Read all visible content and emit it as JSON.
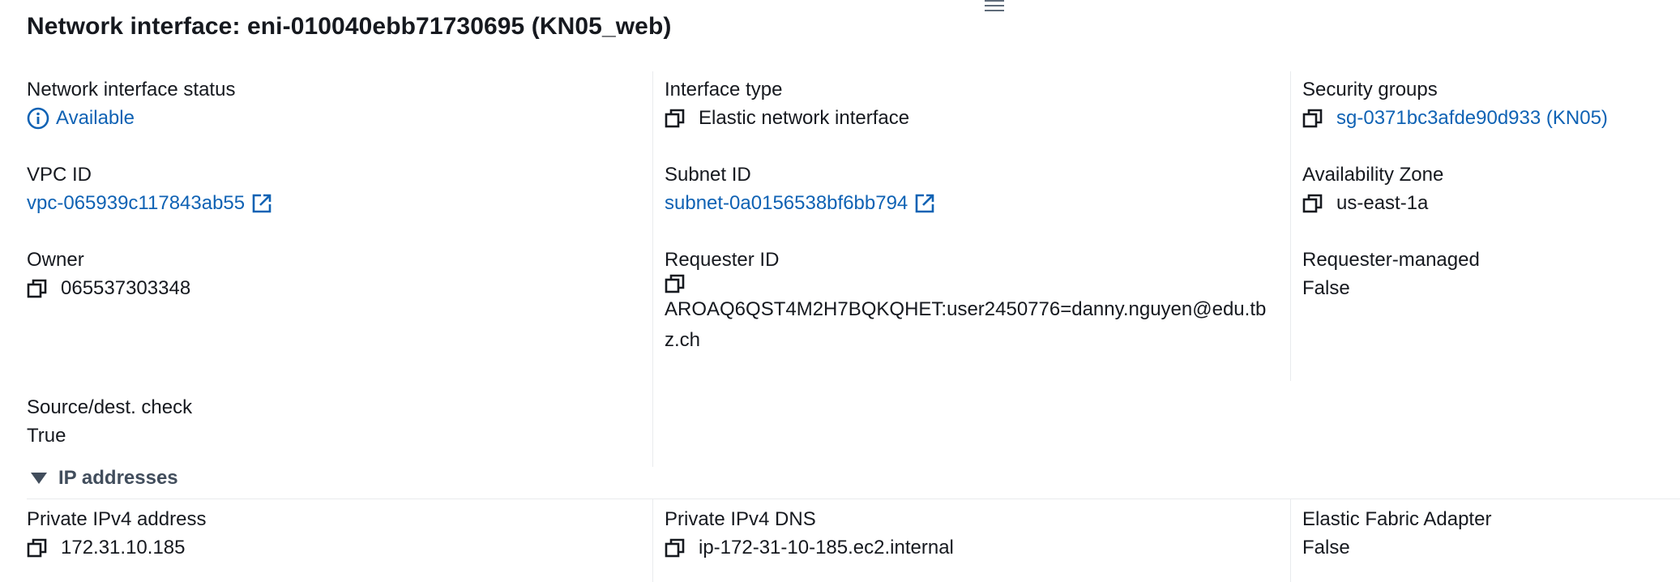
{
  "header": {
    "title": "Network interface: eni-010040ebb71730695 (KN05_web)"
  },
  "details": {
    "status": {
      "label": "Network interface status",
      "value": "Available"
    },
    "interface_type": {
      "label": "Interface type",
      "value": "Elastic network interface"
    },
    "security_groups": {
      "label": "Security groups",
      "value": "sg-0371bc3afde90d933 (KN05)"
    },
    "vpc_id": {
      "label": "VPC ID",
      "value": "vpc-065939c117843ab55"
    },
    "subnet_id": {
      "label": "Subnet ID",
      "value": "subnet-0a0156538bf6bb794"
    },
    "availability_zone": {
      "label": "Availability Zone",
      "value": "us-east-1a"
    },
    "owner": {
      "label": "Owner",
      "value": "065537303348"
    },
    "requester_id": {
      "label": "Requester ID",
      "value_line1": "AROAQ6QST4M2H7BQKQHET:user2450776=danny.nguyen@edu.tb",
      "value_line2": "z.ch"
    },
    "requester_managed": {
      "label": "Requester-managed",
      "value": "False"
    },
    "source_dest_check": {
      "label": "Source/dest. check",
      "value": "True"
    }
  },
  "ip_section": {
    "title": "IP addresses",
    "expanded": true,
    "private_ipv4": {
      "label": "Private IPv4 address",
      "value": "172.31.10.185"
    },
    "private_dns": {
      "label": "Private IPv4 DNS",
      "value": "ip-172-31-10-185.ec2.internal"
    },
    "efa": {
      "label": "Elastic Fabric Adapter",
      "value": "False"
    }
  },
  "colors": {
    "text": "#16191f",
    "link": "#0f62b4",
    "divider": "#e9ebed",
    "muted": "#414d5c"
  },
  "icons": [
    "drag-handle-icon",
    "info-icon",
    "copy-icon",
    "external-link-icon",
    "caret-down-icon"
  ]
}
